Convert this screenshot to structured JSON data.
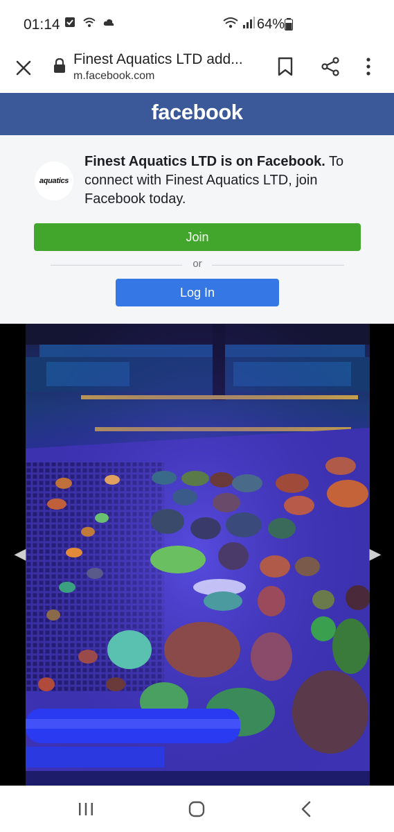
{
  "status_bar": {
    "time": "01:14",
    "battery": "64%",
    "icons": [
      "checkbox-notification-icon",
      "wifi-calling-icon",
      "cloud-icon",
      "wifi-icon",
      "signal-icon",
      "battery-icon"
    ]
  },
  "browser": {
    "page_title": "Finest Aquatics LTD add...",
    "url": "m.facebook.com",
    "icons": [
      "close-icon",
      "lock-icon",
      "bookmark-icon",
      "share-icon",
      "more-vert-icon"
    ]
  },
  "facebook": {
    "logo": "facebook",
    "brand_color": "#3b5998",
    "avatar_text": "aquatics",
    "promo_bold": "Finest Aquatics LTD is on Facebook.",
    "promo_rest": " To connect with Finest Aquatics LTD, join Facebook today.",
    "join_label": "Join",
    "or_label": "or",
    "login_label": "Log In",
    "join_color": "#42a62c",
    "login_color": "#3578e5"
  },
  "viewer": {
    "prev_icon": "chevron-left-icon",
    "next_icon": "chevron-right-icon"
  },
  "nav_bar": {
    "icons": [
      "recents-icon",
      "home-icon",
      "back-icon"
    ]
  }
}
